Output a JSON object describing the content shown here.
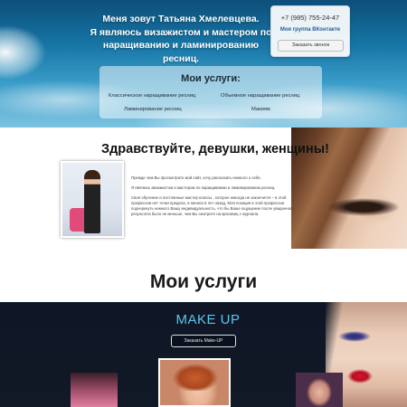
{
  "hero": {
    "intro": "Меня зовут Татьяна Хмелевцева.\nЯ являюсь визажистом и мастером по наращиванию и ламинированию ресниц."
  },
  "contact": {
    "phone": "+7 (985) 755-24-47",
    "vk_group": "Моя группа ВКонтакте",
    "call_button": "Заказать звонок"
  },
  "services_box": {
    "title": "Мои услуги:",
    "items": [
      "Классическое наращивание ресниц",
      "Объемное наращивание ресниц",
      "Ламинирование ресниц",
      "Макияж"
    ]
  },
  "greeting": {
    "title": "Здравствуйте, девушки, женщины!",
    "paragraphs": [
      "Прежде чем Вы просмотрите мой сайт, хочу рассказать немного о себе.",
      "Я являюсь визажистом и мастером по наращиванию и ламинированию ресниц.",
      "Своё обучение и постоянные мастер классы , которое никогда не закончится – в этой профессии нет точки предела, я начала 5 лет назад. Моя позиция в этой профессии подчеркнуть немного Вашу индивидуальность, что бы Ваше ощущение после увиденного результата было не меньше, чем Вы смотрите на красавиц с журнала."
    ]
  },
  "my_services": {
    "title": "Мои услуги"
  },
  "makeup": {
    "title": "MAKE UP",
    "button": "Заказать Make-UP"
  }
}
